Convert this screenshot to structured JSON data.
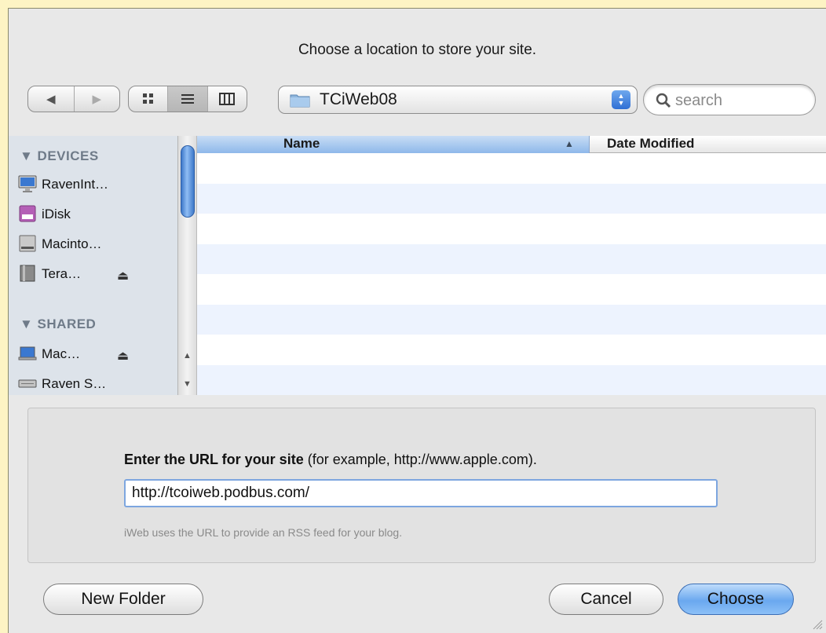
{
  "dialog": {
    "prompt": "Choose a location to store your site."
  },
  "toolbar": {
    "back_icon": "◀",
    "forward_icon": "▶",
    "location": "TCiWeb08",
    "search_placeholder": "search"
  },
  "sidebar": {
    "devices_header": "▼ DEVICES",
    "shared_header": "▼ SHARED",
    "devices": [
      {
        "label": "RavenInt…",
        "icon": "imac-icon"
      },
      {
        "label": "iDisk",
        "icon": "idisk-icon"
      },
      {
        "label": "Macinto…",
        "icon": "hard-drive-icon"
      },
      {
        "label": "Tera…",
        "icon": "external-drive-icon",
        "eject": "⏏"
      }
    ],
    "shared": [
      {
        "label": "Mac…",
        "icon": "laptop-icon",
        "eject": "⏏"
      },
      {
        "label": "Raven S…",
        "icon": "server-icon"
      }
    ]
  },
  "file_list": {
    "columns": [
      "Name",
      "Date Modified"
    ],
    "sort_indicator": "▲",
    "row_count": 8
  },
  "url_panel": {
    "label_bold": "Enter the URL for your site",
    "label_rest": " (for example, http://www.apple.com).",
    "value": "http://tcoiweb.podbus.com/",
    "hint": "iWeb uses the URL to provide an RSS feed for your blog."
  },
  "buttons": {
    "new_folder": "New Folder",
    "cancel": "Cancel",
    "choose": "Choose"
  },
  "colors": {
    "background": "#fdf4c4",
    "sheet": "#e8e8e8",
    "selected_column": "#8eb8ea",
    "sidebar": "#dde3ea"
  }
}
